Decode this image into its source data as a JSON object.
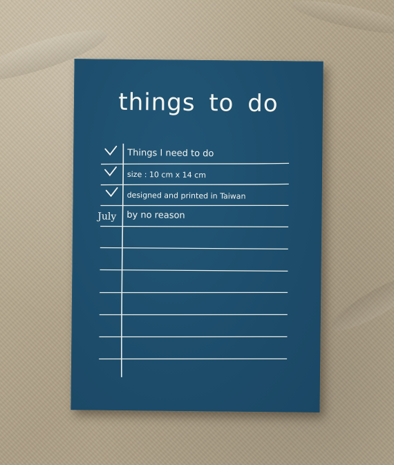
{
  "notepad": {
    "title": "things to do",
    "rows": [
      {
        "checked": true,
        "text": "Things I need to do"
      },
      {
        "checked": true,
        "text": "size : 10 cm x 14 cm"
      },
      {
        "checked": true,
        "text": "designed and printed in Taiwan"
      },
      {
        "date": "July",
        "text": "by no reason"
      }
    ],
    "empty_rows": 7,
    "colors": {
      "paper": "#1e5070",
      "ink": "#f4f4ef",
      "background_fabric": "#b9ab92"
    }
  }
}
